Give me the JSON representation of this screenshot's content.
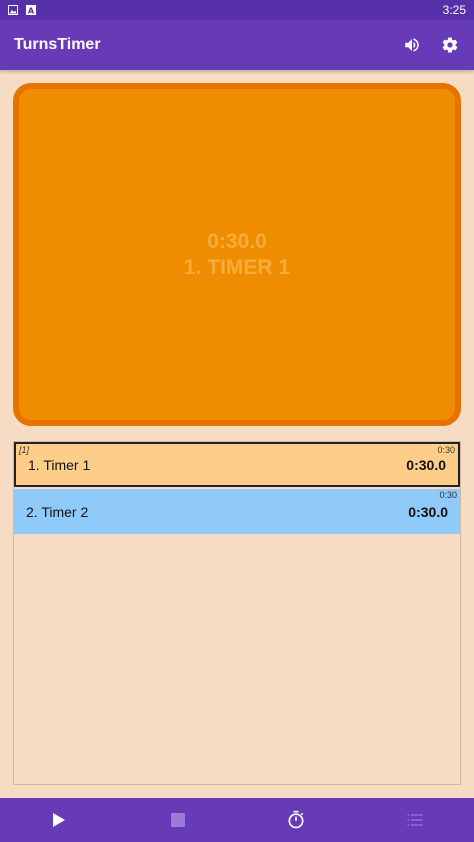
{
  "status_bar": {
    "time": "3:25",
    "icons": [
      "image-icon",
      "text-icon"
    ]
  },
  "app_bar": {
    "title": "TurnsTimer",
    "actions": [
      "volume-icon",
      "gear-icon"
    ]
  },
  "current_timer": {
    "time": "0:30.0",
    "name": "1. TIMER 1"
  },
  "timers": [
    {
      "index_label": "[1]",
      "limit": "0:30",
      "name": "1. Timer 1",
      "time": "0:30.0",
      "active": true
    },
    {
      "index_label": "",
      "limit": "0:30",
      "name": "2. Timer 2",
      "time": "0:30.0",
      "active": false
    }
  ],
  "bottom_bar": {
    "buttons": [
      "play-icon",
      "stop-icon",
      "stopwatch-icon",
      "list-icon"
    ]
  },
  "colors": {
    "primary": "#673ab7",
    "status_bar": "#5530a8",
    "background": "#f6dcc3",
    "timer_panel": "#f08c00",
    "timer_border": "#e67300",
    "active_row": "#ffcd8a",
    "normal_row": "#90caf9"
  }
}
